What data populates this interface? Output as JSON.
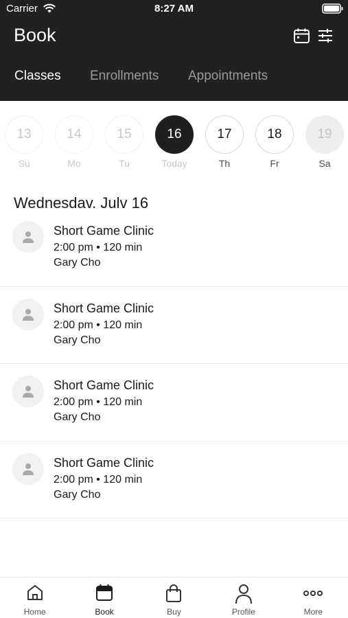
{
  "status_bar": {
    "carrier": "Carrier",
    "time": "8:27 AM"
  },
  "header": {
    "title": "Book",
    "icons": [
      "calendar-icon",
      "filter-icon"
    ]
  },
  "tabs": [
    {
      "label": "Classes",
      "active": true
    },
    {
      "label": "Enrollments",
      "active": false
    },
    {
      "label": "Appointments",
      "active": false
    }
  ],
  "date_strip": [
    {
      "number": "13",
      "label": "Su",
      "state": "past"
    },
    {
      "number": "14",
      "label": "Mo",
      "state": "past"
    },
    {
      "number": "15",
      "label": "Tu",
      "state": "past"
    },
    {
      "number": "16",
      "label": "Today",
      "state": "selected"
    },
    {
      "number": "17",
      "label": "Th",
      "state": "future"
    },
    {
      "number": "18",
      "label": "Fr",
      "state": "future"
    },
    {
      "number": "19",
      "label": "Sa",
      "state": "disabled"
    }
  ],
  "date_heading": "Wednesdav. Julv 16",
  "classes": [
    {
      "name": "Short Game Clinic",
      "time": "2:00 pm • 120 min",
      "instructor": "Gary Cho"
    },
    {
      "name": "Short Game Clinic",
      "time": "2:00 pm • 120 min",
      "instructor": "Gary Cho"
    },
    {
      "name": "Short Game Clinic",
      "time": "2:00 pm • 120 min",
      "instructor": "Gary Cho"
    },
    {
      "name": "Short Game Clinic",
      "time": "2:00 pm • 120 min",
      "instructor": "Gary Cho"
    }
  ],
  "bottom_nav": [
    {
      "label": "Home",
      "icon": "home-icon",
      "active": false
    },
    {
      "label": "Book",
      "icon": "calendar-icon",
      "active": true
    },
    {
      "label": "Buy",
      "icon": "shopping-bag-icon",
      "active": false
    },
    {
      "label": "Profile",
      "icon": "person-icon",
      "active": false
    },
    {
      "label": "More",
      "icon": "more-dots-icon",
      "active": false
    }
  ],
  "colors": {
    "header_bg": "#222120",
    "selected_day": "#1f1f1f",
    "inactive_tab": "#9a9a9a"
  }
}
